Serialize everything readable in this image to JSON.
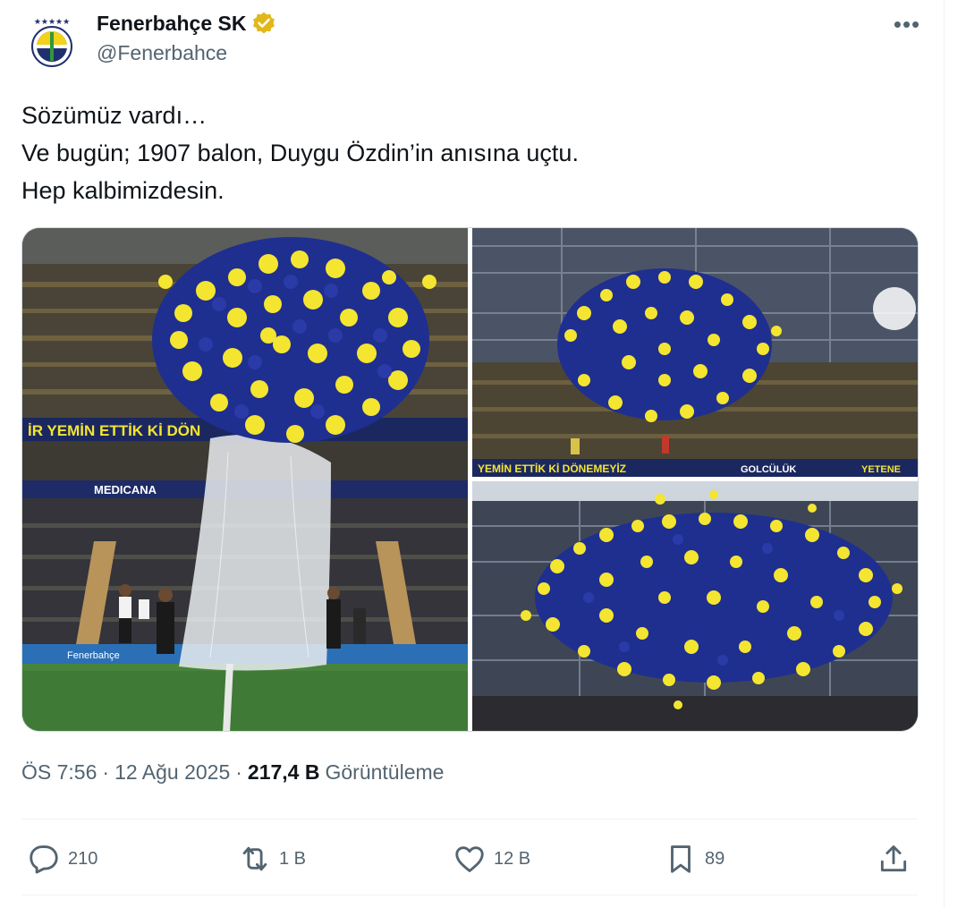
{
  "tweet": {
    "author": {
      "display_name": "Fenerbahçe SK",
      "handle": "@Fenerbahce",
      "verified": true,
      "verified_color": "#e2b719"
    },
    "lines": [
      "Sözümüz vardı…",
      "Ve bugün; 1907 balon, Duygu Özdin’in anısına uçtu.",
      "Hep kalbimizdesin."
    ],
    "meta": {
      "time": "ÖS 7:56",
      "date": "12 Ağu 2025",
      "views_count": "217,4 B",
      "views_label": "Görüntüleme"
    },
    "media": {
      "photos": [
        {
          "description": "stadium-balloon-release-net"
        },
        {
          "description": "balloon-cluster-rising"
        },
        {
          "description": "balloons-dispersing"
        }
      ],
      "banner_texts": [
        "İR YEMİN ETTİK Kİ DÖN",
        "MEDICANA",
        "Fenerbahçe",
        "YEMİN ETTİK Kİ DÖNEMEYİZ",
        "GOLCÜLÜK",
        "YETENE"
      ]
    },
    "actions": {
      "replies": "210",
      "retweets": "1 B",
      "likes": "12 B",
      "bookmarks": "89"
    },
    "colors": {
      "balloon_yellow": "#f4e531",
      "balloon_navy": "#1f2f8f",
      "text_secondary": "#536471"
    }
  }
}
